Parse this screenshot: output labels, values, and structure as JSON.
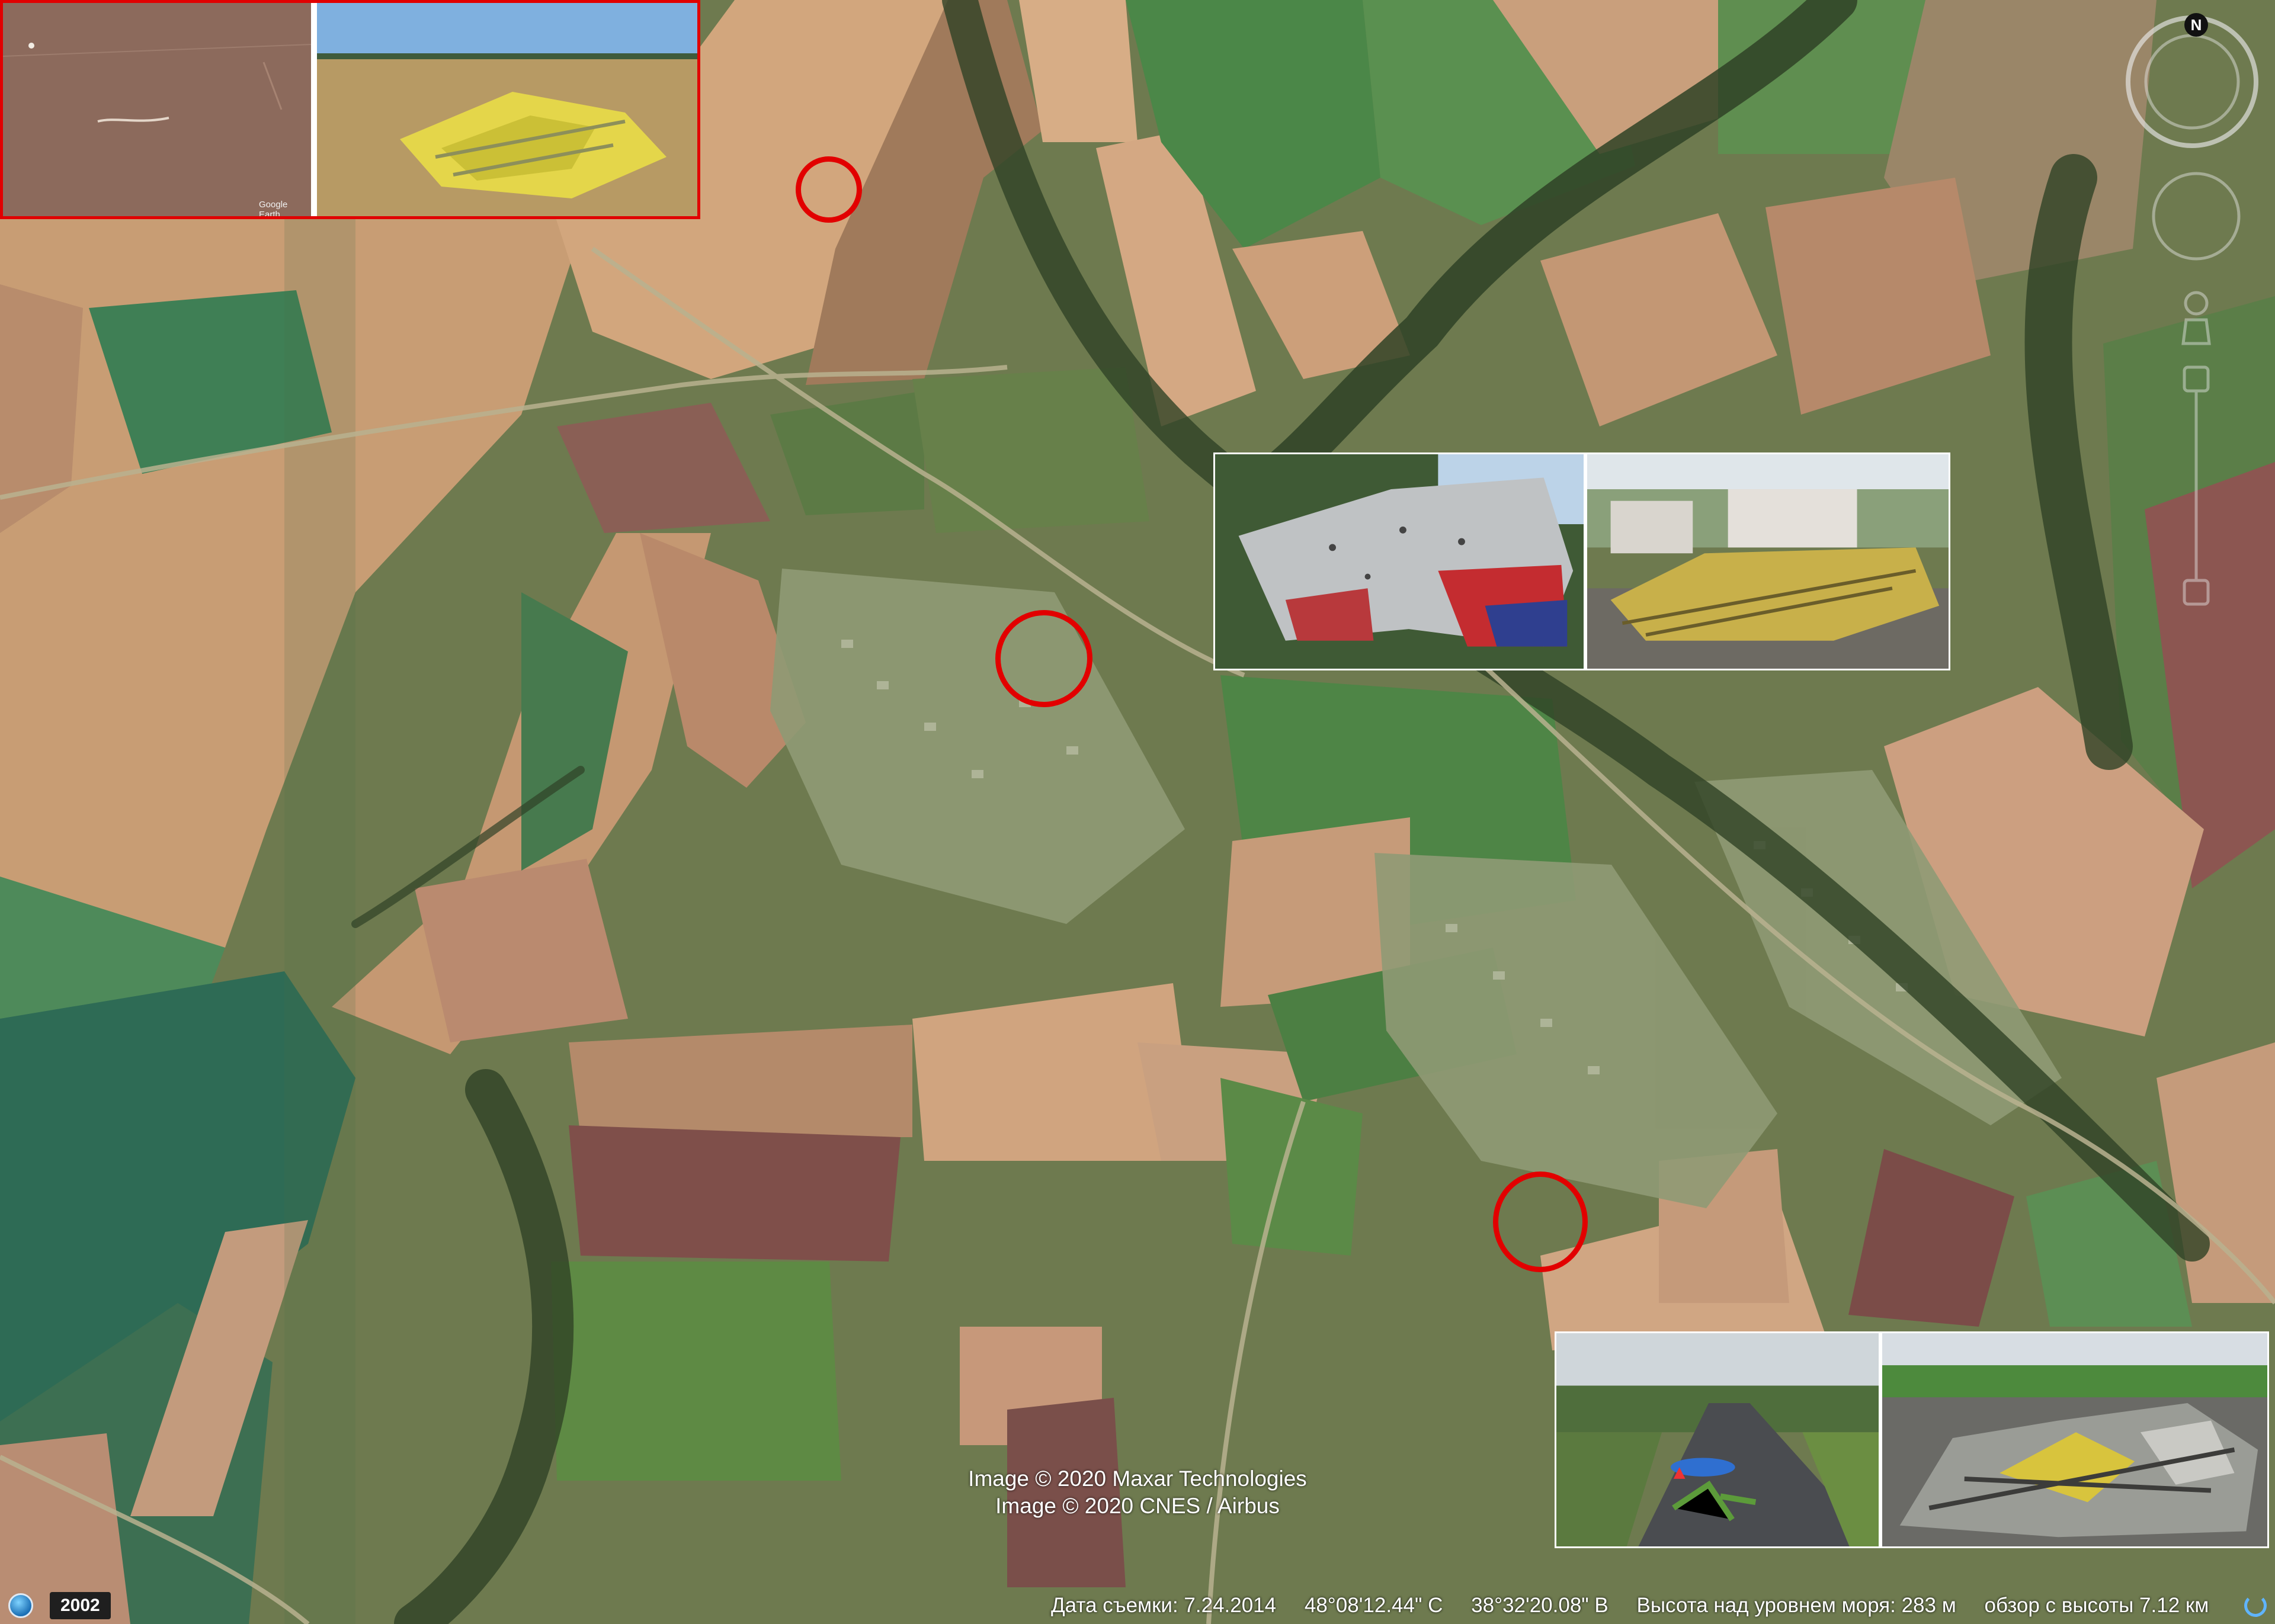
{
  "map": {
    "attribution_lines": [
      "Image © 2020 Maxar Technologies",
      "Image © 2020 CNES / Airbus"
    ],
    "inset_attribution": "Google Earth",
    "compass_label": "N",
    "marker_color": "#e20000"
  },
  "statusbar": {
    "historical_year": "2002",
    "capture_date": "Дата съемки: 7.24.2014",
    "latitude": "48°08'12.44\" С",
    "longitude": "38°32'20.08\" В",
    "elevation": "Высота над уровнем моря:   283 м",
    "eye_altitude": "обзор с высоты   7.12 км"
  }
}
